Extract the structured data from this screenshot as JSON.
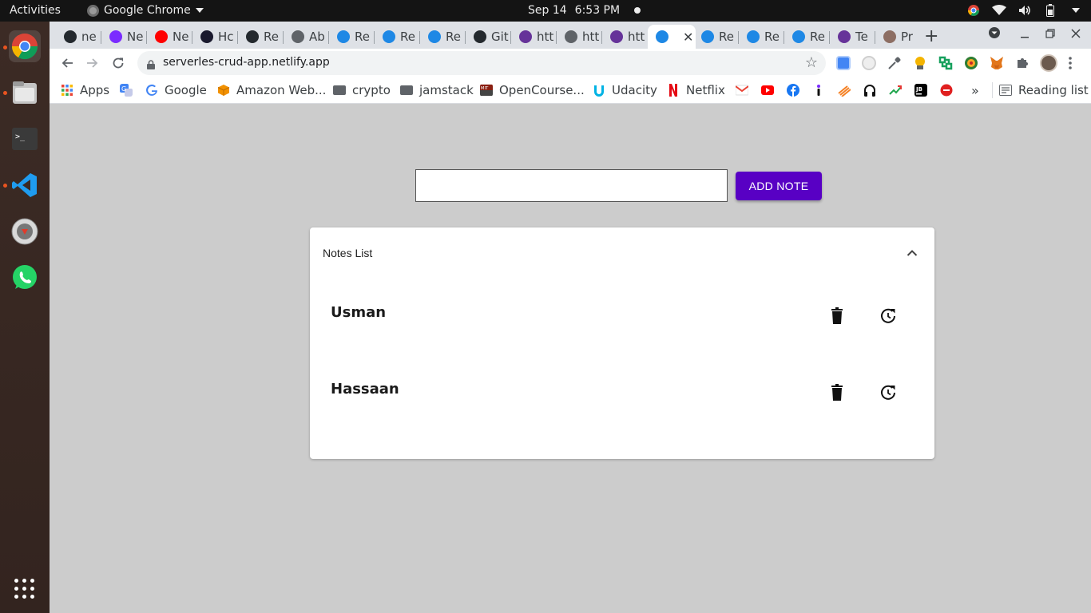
{
  "topbar": {
    "activities": "Activities",
    "app_name": "Google Chrome",
    "date": "Sep 14",
    "time": "6:53 PM"
  },
  "dock": {
    "items": [
      "chrome-icon",
      "files-icon",
      "terminal-icon",
      "vscode-icon",
      "installer-icon",
      "whatsapp-icon",
      "apps-grid-icon"
    ]
  },
  "tabs": [
    {
      "label": "ne",
      "icon": "github-icon"
    },
    {
      "label": "Ne",
      "icon": "ion-icon"
    },
    {
      "label": "Ne",
      "icon": "youtube-icon"
    },
    {
      "label": "Hc",
      "icon": "a-icon"
    },
    {
      "label": "Re",
      "icon": "github-icon"
    },
    {
      "label": "Ab",
      "icon": "globe-icon"
    },
    {
      "label": "Re",
      "icon": "react-icon"
    },
    {
      "label": "Re",
      "icon": "react-icon"
    },
    {
      "label": "Re",
      "icon": "react-icon"
    },
    {
      "label": "Git",
      "icon": "github-icon"
    },
    {
      "label": "htt",
      "icon": "gatsby-icon"
    },
    {
      "label": "htt",
      "icon": "globe-icon"
    },
    {
      "label": "htt",
      "icon": "gatsby-icon"
    },
    {
      "label": "",
      "icon": "react-icon"
    },
    {
      "label": "Re",
      "icon": "react-icon"
    },
    {
      "label": "Re",
      "icon": "react-icon"
    },
    {
      "label": "Re",
      "icon": "react-icon"
    },
    {
      "label": "Te",
      "icon": "gatsby-icon"
    },
    {
      "label": "Pr",
      "icon": "photo-icon"
    }
  ],
  "toolbar": {
    "url": "serverles-crud-app.netlify.app"
  },
  "bookmarks": {
    "apps": "Apps",
    "google": "Google",
    "aws": "Amazon Web...",
    "crypto": "crypto",
    "jamstack": "jamstack",
    "ocw": "OpenCourse...",
    "udacity": "Udacity",
    "netflix": "Netflix",
    "more": "»",
    "reading_list": "Reading list"
  },
  "app": {
    "input_value": "",
    "add_button": "ADD NOTE",
    "panel_title": "Notes List",
    "notes": [
      {
        "text": "Usman"
      },
      {
        "text": "Hassaan"
      }
    ]
  },
  "colors": {
    "accent": "#5800c4",
    "page_bg": "#cccccc"
  }
}
